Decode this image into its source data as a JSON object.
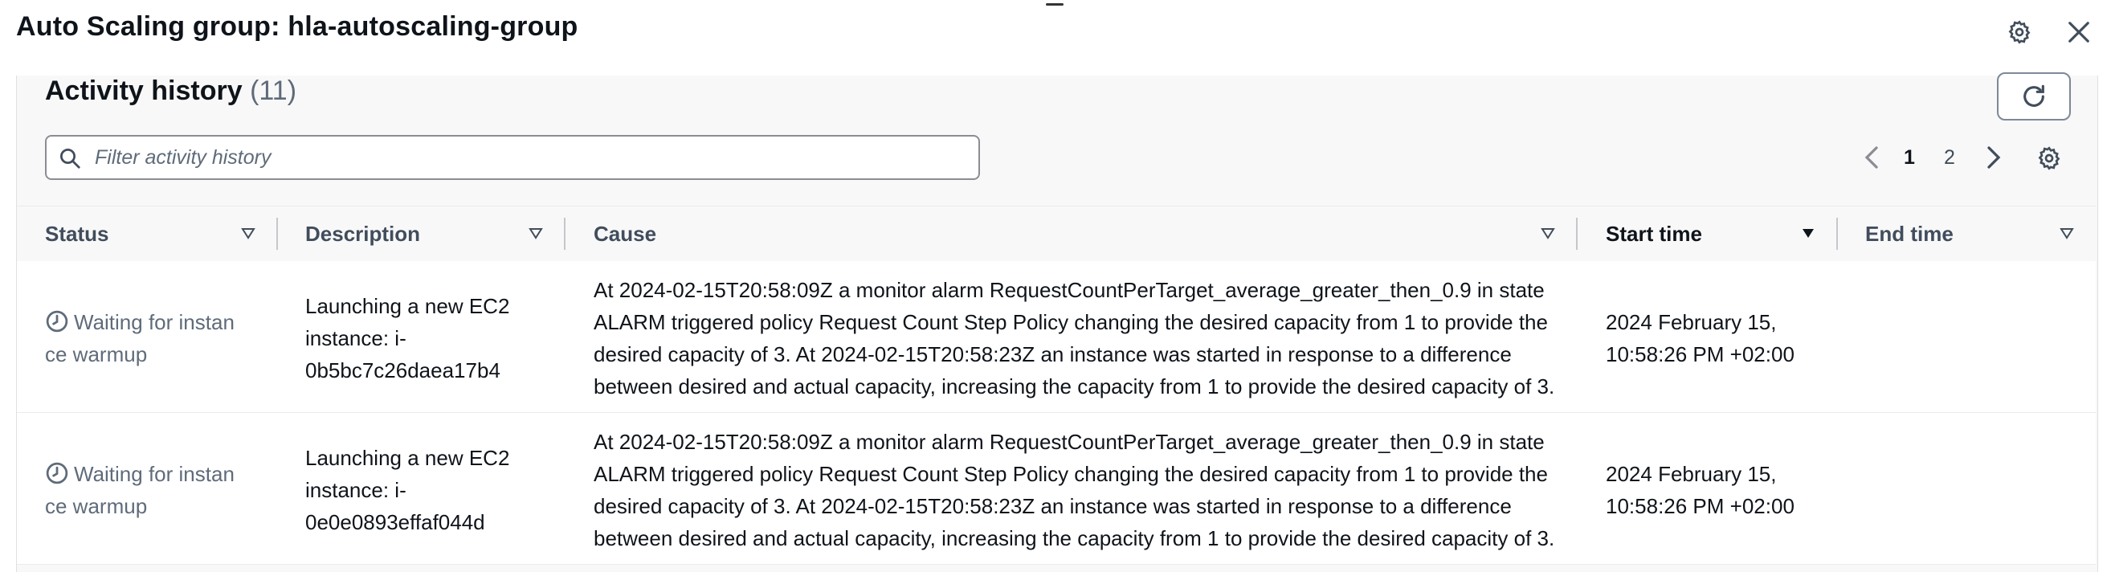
{
  "header": {
    "title": "Auto Scaling group: hla-autoscaling-group"
  },
  "activity": {
    "title": "Activity history",
    "count": "(11)",
    "search_placeholder": "Filter activity history",
    "pagination": {
      "pages": [
        "1",
        "2"
      ],
      "current": "1"
    }
  },
  "table": {
    "columns": [
      "Status",
      "Description",
      "Cause",
      "Start time",
      "End time"
    ],
    "sorted_column": "Start time",
    "rows": [
      {
        "status_line1": "Waiting for instan",
        "status_line2": "ce warmup",
        "desc_line1": "Launching a new EC2",
        "desc_line2": "instance: i-",
        "desc_line3": "0b5bc7c26daea17b4",
        "cause_line1": "At 2024-02-15T20:58:09Z a monitor alarm RequestCountPerTarget_average_greater_then_0.9 in state",
        "cause_line2": "ALARM triggered policy Request Count Step Policy changing the desired capacity from 1 to provide the",
        "cause_line3": "desired capacity of 3. At 2024-02-15T20:58:23Z an instance was started in response to a difference",
        "cause_line4": "between desired and actual capacity, increasing the capacity from 1 to provide the desired capacity of 3.",
        "start_line1": "2024 February 15,",
        "start_line2": "10:58:26 PM +02:00",
        "end_time": ""
      },
      {
        "status_line1": "Waiting for instan",
        "status_line2": "ce warmup",
        "desc_line1": "Launching a new EC2",
        "desc_line2": "instance: i-",
        "desc_line3": "0e0e0893effaf044d",
        "cause_line1": "At 2024-02-15T20:58:09Z a monitor alarm RequestCountPerTarget_average_greater_then_0.9 in state",
        "cause_line2": "ALARM triggered policy Request Count Step Policy changing the desired capacity from 1 to provide the",
        "cause_line3": "desired capacity of 3. At 2024-02-15T20:58:23Z an instance was started in response to a difference",
        "cause_line4": "between desired and actual capacity, increasing the capacity from 1 to provide the desired capacity of 3.",
        "start_line1": "2024 February 15,",
        "start_line2": "10:58:26 PM +02:00",
        "end_time": ""
      }
    ]
  },
  "icons": {
    "header_settings": "gear-icon",
    "close": "close-icon",
    "refresh": "refresh-icon",
    "search": "search-icon",
    "prev": "chevron-left-icon",
    "next": "chevron-right-icon",
    "table_settings": "gear-icon",
    "sort": "caret-down-icon",
    "status": "clock-icon"
  },
  "colors": {
    "text": "#0f141a",
    "muted": "#5f6b7a",
    "panel_bg": "#f8f8f8",
    "border": "#8c8c94"
  }
}
